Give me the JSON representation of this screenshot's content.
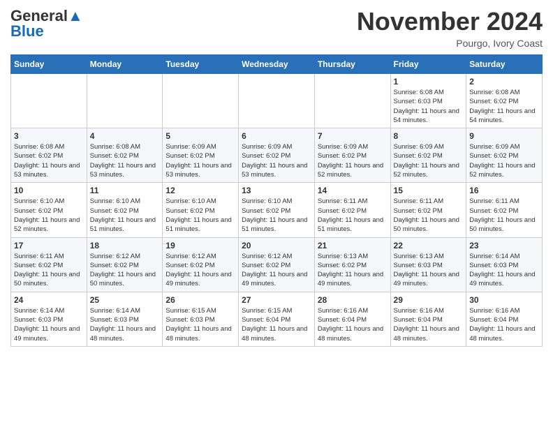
{
  "header": {
    "logo_general": "General",
    "logo_blue": "Blue",
    "month_title": "November 2024",
    "location": "Pourgo, Ivory Coast"
  },
  "calendar": {
    "weekdays": [
      "Sunday",
      "Monday",
      "Tuesday",
      "Wednesday",
      "Thursday",
      "Friday",
      "Saturday"
    ],
    "weeks": [
      [
        {
          "day": "",
          "sunrise": "",
          "sunset": "",
          "daylight": ""
        },
        {
          "day": "",
          "sunrise": "",
          "sunset": "",
          "daylight": ""
        },
        {
          "day": "",
          "sunrise": "",
          "sunset": "",
          "daylight": ""
        },
        {
          "day": "",
          "sunrise": "",
          "sunset": "",
          "daylight": ""
        },
        {
          "day": "",
          "sunrise": "",
          "sunset": "",
          "daylight": ""
        },
        {
          "day": "1",
          "sunrise": "Sunrise: 6:08 AM",
          "sunset": "Sunset: 6:03 PM",
          "daylight": "Daylight: 11 hours and 54 minutes."
        },
        {
          "day": "2",
          "sunrise": "Sunrise: 6:08 AM",
          "sunset": "Sunset: 6:02 PM",
          "daylight": "Daylight: 11 hours and 54 minutes."
        }
      ],
      [
        {
          "day": "3",
          "sunrise": "Sunrise: 6:08 AM",
          "sunset": "Sunset: 6:02 PM",
          "daylight": "Daylight: 11 hours and 53 minutes."
        },
        {
          "day": "4",
          "sunrise": "Sunrise: 6:08 AM",
          "sunset": "Sunset: 6:02 PM",
          "daylight": "Daylight: 11 hours and 53 minutes."
        },
        {
          "day": "5",
          "sunrise": "Sunrise: 6:09 AM",
          "sunset": "Sunset: 6:02 PM",
          "daylight": "Daylight: 11 hours and 53 minutes."
        },
        {
          "day": "6",
          "sunrise": "Sunrise: 6:09 AM",
          "sunset": "Sunset: 6:02 PM",
          "daylight": "Daylight: 11 hours and 53 minutes."
        },
        {
          "day": "7",
          "sunrise": "Sunrise: 6:09 AM",
          "sunset": "Sunset: 6:02 PM",
          "daylight": "Daylight: 11 hours and 52 minutes."
        },
        {
          "day": "8",
          "sunrise": "Sunrise: 6:09 AM",
          "sunset": "Sunset: 6:02 PM",
          "daylight": "Daylight: 11 hours and 52 minutes."
        },
        {
          "day": "9",
          "sunrise": "Sunrise: 6:09 AM",
          "sunset": "Sunset: 6:02 PM",
          "daylight": "Daylight: 11 hours and 52 minutes."
        }
      ],
      [
        {
          "day": "10",
          "sunrise": "Sunrise: 6:10 AM",
          "sunset": "Sunset: 6:02 PM",
          "daylight": "Daylight: 11 hours and 52 minutes."
        },
        {
          "day": "11",
          "sunrise": "Sunrise: 6:10 AM",
          "sunset": "Sunset: 6:02 PM",
          "daylight": "Daylight: 11 hours and 51 minutes."
        },
        {
          "day": "12",
          "sunrise": "Sunrise: 6:10 AM",
          "sunset": "Sunset: 6:02 PM",
          "daylight": "Daylight: 11 hours and 51 minutes."
        },
        {
          "day": "13",
          "sunrise": "Sunrise: 6:10 AM",
          "sunset": "Sunset: 6:02 PM",
          "daylight": "Daylight: 11 hours and 51 minutes."
        },
        {
          "day": "14",
          "sunrise": "Sunrise: 6:11 AM",
          "sunset": "Sunset: 6:02 PM",
          "daylight": "Daylight: 11 hours and 51 minutes."
        },
        {
          "day": "15",
          "sunrise": "Sunrise: 6:11 AM",
          "sunset": "Sunset: 6:02 PM",
          "daylight": "Daylight: 11 hours and 50 minutes."
        },
        {
          "day": "16",
          "sunrise": "Sunrise: 6:11 AM",
          "sunset": "Sunset: 6:02 PM",
          "daylight": "Daylight: 11 hours and 50 minutes."
        }
      ],
      [
        {
          "day": "17",
          "sunrise": "Sunrise: 6:11 AM",
          "sunset": "Sunset: 6:02 PM",
          "daylight": "Daylight: 11 hours and 50 minutes."
        },
        {
          "day": "18",
          "sunrise": "Sunrise: 6:12 AM",
          "sunset": "Sunset: 6:02 PM",
          "daylight": "Daylight: 11 hours and 50 minutes."
        },
        {
          "day": "19",
          "sunrise": "Sunrise: 6:12 AM",
          "sunset": "Sunset: 6:02 PM",
          "daylight": "Daylight: 11 hours and 49 minutes."
        },
        {
          "day": "20",
          "sunrise": "Sunrise: 6:12 AM",
          "sunset": "Sunset: 6:02 PM",
          "daylight": "Daylight: 11 hours and 49 minutes."
        },
        {
          "day": "21",
          "sunrise": "Sunrise: 6:13 AM",
          "sunset": "Sunset: 6:02 PM",
          "daylight": "Daylight: 11 hours and 49 minutes."
        },
        {
          "day": "22",
          "sunrise": "Sunrise: 6:13 AM",
          "sunset": "Sunset: 6:03 PM",
          "daylight": "Daylight: 11 hours and 49 minutes."
        },
        {
          "day": "23",
          "sunrise": "Sunrise: 6:14 AM",
          "sunset": "Sunset: 6:03 PM",
          "daylight": "Daylight: 11 hours and 49 minutes."
        }
      ],
      [
        {
          "day": "24",
          "sunrise": "Sunrise: 6:14 AM",
          "sunset": "Sunset: 6:03 PM",
          "daylight": "Daylight: 11 hours and 49 minutes."
        },
        {
          "day": "25",
          "sunrise": "Sunrise: 6:14 AM",
          "sunset": "Sunset: 6:03 PM",
          "daylight": "Daylight: 11 hours and 48 minutes."
        },
        {
          "day": "26",
          "sunrise": "Sunrise: 6:15 AM",
          "sunset": "Sunset: 6:03 PM",
          "daylight": "Daylight: 11 hours and 48 minutes."
        },
        {
          "day": "27",
          "sunrise": "Sunrise: 6:15 AM",
          "sunset": "Sunset: 6:04 PM",
          "daylight": "Daylight: 11 hours and 48 minutes."
        },
        {
          "day": "28",
          "sunrise": "Sunrise: 6:16 AM",
          "sunset": "Sunset: 6:04 PM",
          "daylight": "Daylight: 11 hours and 48 minutes."
        },
        {
          "day": "29",
          "sunrise": "Sunrise: 6:16 AM",
          "sunset": "Sunset: 6:04 PM",
          "daylight": "Daylight: 11 hours and 48 minutes."
        },
        {
          "day": "30",
          "sunrise": "Sunrise: 6:16 AM",
          "sunset": "Sunset: 6:04 PM",
          "daylight": "Daylight: 11 hours and 48 minutes."
        }
      ]
    ]
  }
}
